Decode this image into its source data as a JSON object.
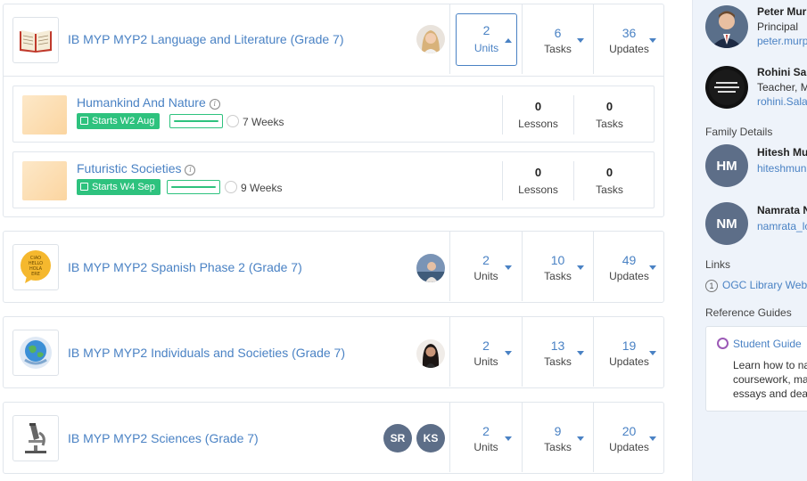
{
  "courses": [
    {
      "title": "IB MYP MYP2 Language and Literature (Grade 7)",
      "stats": [
        {
          "value": "2",
          "label": "Units"
        },
        {
          "value": "6",
          "label": "Tasks"
        },
        {
          "value": "36",
          "label": "Updates"
        }
      ],
      "units": [
        {
          "title": "Humankind And Nature",
          "starts": "Starts W2 Aug",
          "weeks": "7 Weeks",
          "lessons_value": "0",
          "lessons_label": "Lessons",
          "tasks_value": "0",
          "tasks_label": "Tasks"
        },
        {
          "title": "Futuristic Societies",
          "starts": "Starts W4 Sep",
          "weeks": "9 Weeks",
          "lessons_value": "0",
          "lessons_label": "Lessons",
          "tasks_value": "0",
          "tasks_label": "Tasks"
        }
      ]
    },
    {
      "title": "IB MYP MYP2 Spanish Phase 2 (Grade 7)",
      "stats": [
        {
          "value": "2",
          "label": "Units"
        },
        {
          "value": "10",
          "label": "Tasks"
        },
        {
          "value": "49",
          "label": "Updates"
        }
      ],
      "thumb_lines": [
        "CIAO",
        "HELLO",
        "HOLA",
        "ERE"
      ]
    },
    {
      "title": "IB MYP MYP2 Individuals and Societies (Grade 7)",
      "stats": [
        {
          "value": "2",
          "label": "Units"
        },
        {
          "value": "13",
          "label": "Tasks"
        },
        {
          "value": "19",
          "label": "Updates"
        }
      ]
    },
    {
      "title": "IB MYP MYP2 Sciences (Grade 7)",
      "stats": [
        {
          "value": "2",
          "label": "Units"
        },
        {
          "value": "9",
          "label": "Tasks"
        },
        {
          "value": "20",
          "label": "Updates"
        }
      ],
      "teachers": [
        "SR",
        "KS"
      ]
    }
  ],
  "sidebar": {
    "staff": [
      {
        "name": "Peter Mur",
        "role": "Principal",
        "email": "peter.murp"
      },
      {
        "name": "Rohini Sal",
        "role": "Teacher, M",
        "email": "rohini.Salas"
      }
    ],
    "family_heading": "Family Details",
    "family": [
      {
        "initials": "HM",
        "name": "Hitesh Mu",
        "email": "hiteshmun"
      },
      {
        "initials": "NM",
        "name": "Namrata N",
        "email": "namrata_lc"
      }
    ],
    "links_heading": "Links",
    "link": {
      "number": "1",
      "label": "OGC Library Webs"
    },
    "guides_heading": "Reference Guides",
    "guide": {
      "title": "Student Guide",
      "text": "Learn how to na coursework, ma essays and dead"
    }
  },
  "colors": {
    "accent": "#4a82c4",
    "badge_green": "#2ec27e",
    "avatar_slate": "#5d6e88"
  }
}
